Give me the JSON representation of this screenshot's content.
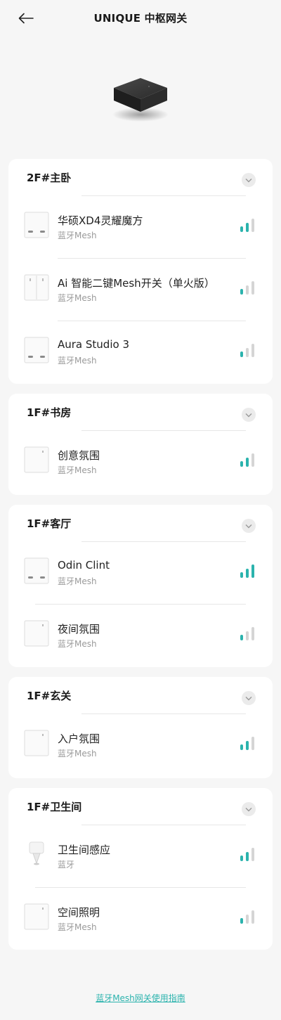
{
  "header": {
    "title": "UNIQUE 中枢网关"
  },
  "colors": {
    "accent": "#2bb3ad",
    "signal_inactive": "#d5d5d5"
  },
  "rooms": [
    {
      "name": "2F#主卧",
      "devices": [
        {
          "name": "华硕XD4灵耀魔方",
          "sub": "蓝牙Mesh",
          "icon": "switch-double-icon",
          "signal_level": 2
        },
        {
          "name": "Ai 智能二键Mesh开关（单火版）",
          "sub": "蓝牙Mesh",
          "icon": "switch-panel-icon",
          "signal_level": 1
        },
        {
          "name": "Aura Studio 3",
          "sub": "蓝牙Mesh",
          "icon": "switch-double-icon",
          "signal_level": 1
        }
      ]
    },
    {
      "name": "1F#书房",
      "devices": [
        {
          "name": "创意氛围",
          "sub": "蓝牙Mesh",
          "icon": "panel-icon",
          "signal_level": 2
        }
      ]
    },
    {
      "name": "1F#客厅",
      "devices": [
        {
          "name": "Odin Clint",
          "sub": "蓝牙Mesh",
          "icon": "switch-double-icon",
          "signal_level": 3
        },
        {
          "name": "夜间氛围",
          "sub": "蓝牙Mesh",
          "icon": "panel-icon",
          "signal_level": 1
        }
      ]
    },
    {
      "name": "1F#玄关",
      "devices": [
        {
          "name": "入户氛围",
          "sub": "蓝牙Mesh",
          "icon": "panel-icon",
          "signal_level": 2
        }
      ]
    },
    {
      "name": "1F#卫生间",
      "devices": [
        {
          "name": "卫生间感应",
          "sub": "蓝牙",
          "icon": "sensor-icon",
          "signal_level": 2
        },
        {
          "name": "空间照明",
          "sub": "蓝牙Mesh",
          "icon": "panel-icon",
          "signal_level": 1
        }
      ]
    }
  ],
  "footer": {
    "link": "蓝牙Mesh网关使用指南"
  }
}
